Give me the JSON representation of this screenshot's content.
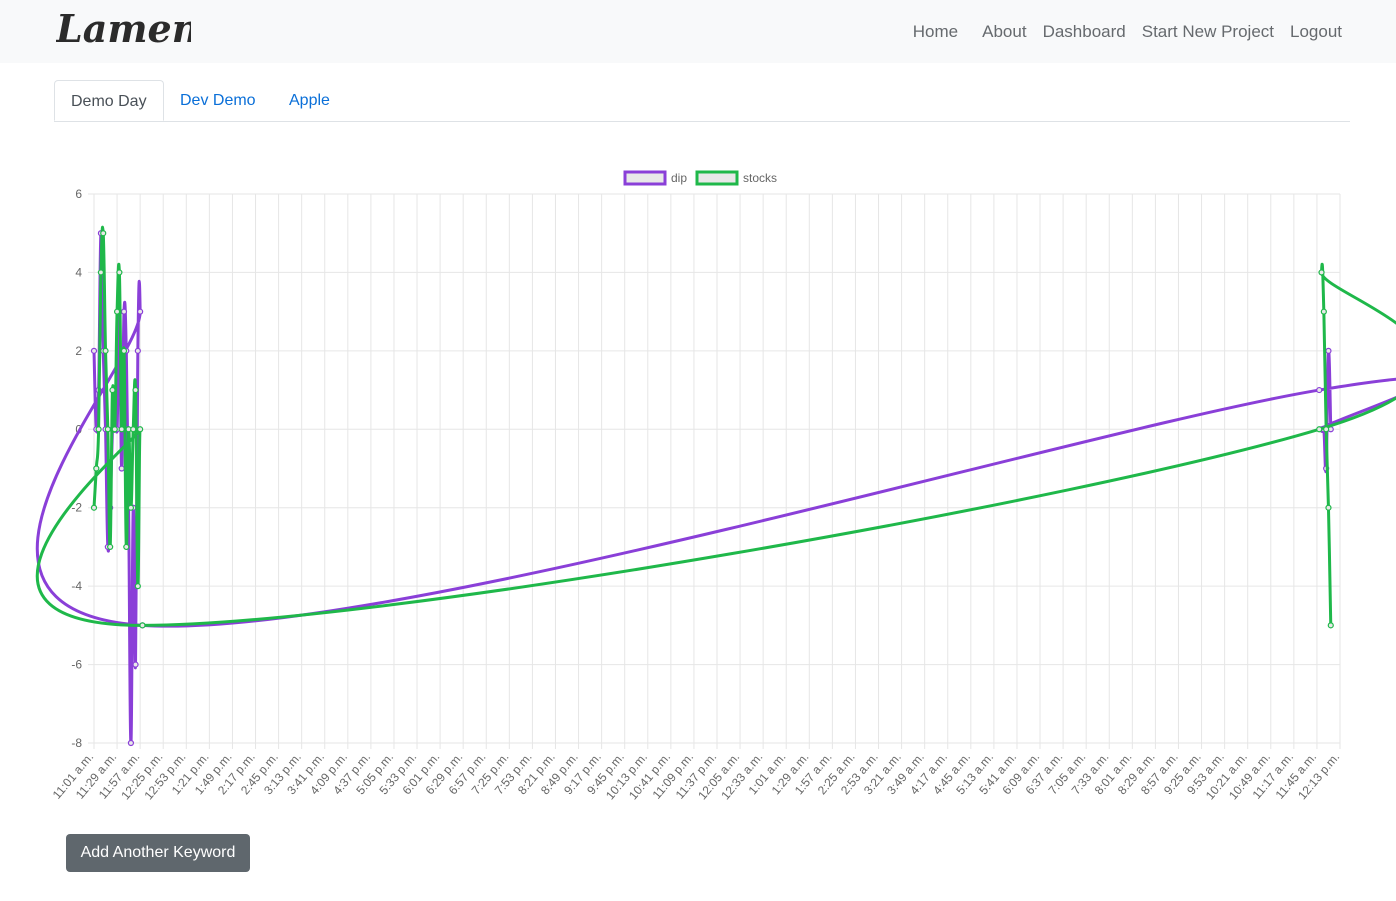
{
  "app": {
    "logo_text": "LamentID"
  },
  "nav": {
    "items": [
      "Home",
      "About",
      "Dashboard",
      "Start New Project",
      "Logout"
    ]
  },
  "tabs": [
    "Demo Day",
    "Dev Demo",
    "Apple"
  ],
  "actions": {
    "add_keyword": "Add Another Keyword"
  },
  "chart_data": {
    "type": "line",
    "legend_position": "top",
    "grid": true,
    "ylim": [
      -8,
      6
    ],
    "y_ticks": [
      6,
      4,
      2,
      0,
      -2,
      -4,
      -6,
      -8
    ],
    "categories": [
      "11:01 a.m.",
      "11:29 a.m.",
      "11:57 a.m.",
      "12:25 p.m.",
      "12:53 p.m.",
      "1:21 p.m.",
      "1:49 p.m.",
      "2:17 p.m.",
      "2:45 p.m.",
      "3:13 p.m.",
      "3:41 p.m.",
      "4:09 p.m.",
      "4:37 p.m.",
      "5:05 p.m.",
      "5:33 p.m.",
      "6:01 p.m.",
      "6:29 p.m.",
      "6:57 p.m.",
      "7:25 p.m.",
      "7:53 p.m.",
      "8:21 p.m.",
      "8:49 p.m.",
      "9:17 p.m.",
      "9:45 p.m.",
      "10:13 p.m.",
      "10:41 p.m.",
      "11:09 p.m.",
      "11:37 p.m.",
      "12:05 a.m.",
      "12:33 a.m.",
      "1:01 a.m.",
      "1:29 a.m.",
      "1:57 a.m.",
      "2:25 a.m.",
      "2:53 a.m.",
      "3:21 a.m.",
      "3:49 a.m.",
      "4:17 a.m.",
      "4:45 a.m.",
      "5:13 a.m.",
      "5:41 a.m.",
      "6:09 a.m.",
      "6:37 a.m.",
      "7:05 a.m.",
      "7:33 a.m.",
      "8:01 a.m.",
      "8:29 a.m.",
      "8:57 a.m.",
      "9:25 a.m.",
      "9:53 a.m.",
      "10:21 a.m.",
      "10:49 a.m.",
      "11:17 a.m.",
      "11:45 a.m.",
      "12:13 p.m."
    ],
    "series": [
      {
        "name": "dip",
        "color": "#8a3fd8",
        "x": [
          0,
          0.1,
          0.2,
          0.3,
          0.4,
          0.5,
          0.6,
          0.7,
          0.8,
          0.9,
          1.0,
          1.1,
          1.2,
          1.3,
          1.4,
          1.5,
          1.6,
          1.7,
          1.8,
          1.9,
          2.0,
          2.1,
          53.1,
          53.2,
          53.3,
          53.4,
          53.5,
          53.6
        ],
        "values": [
          2,
          0,
          1,
          5,
          2,
          0,
          -3,
          -2,
          0,
          1,
          0,
          3,
          -1,
          3,
          2,
          -2,
          -8,
          -2,
          -6,
          2,
          3,
          -5,
          1,
          0,
          0,
          -1,
          2,
          0
        ]
      },
      {
        "name": "stocks",
        "color": "#1fb84a",
        "x": [
          0,
          0.1,
          0.2,
          0.3,
          0.4,
          0.5,
          0.6,
          0.7,
          0.8,
          0.9,
          1.0,
          1.1,
          1.2,
          1.3,
          1.4,
          1.5,
          1.6,
          1.7,
          1.8,
          1.9,
          2.0,
          2.1,
          53.1,
          53.2,
          53.3,
          53.4,
          53.5,
          53.6
        ],
        "values": [
          -2,
          -1,
          0,
          4,
          5,
          2,
          0,
          -3,
          1,
          0,
          3,
          4,
          0,
          2,
          -3,
          0,
          -2,
          0,
          1,
          -4,
          0,
          -5,
          0,
          4,
          3,
          0,
          -2,
          -5
        ]
      }
    ]
  }
}
